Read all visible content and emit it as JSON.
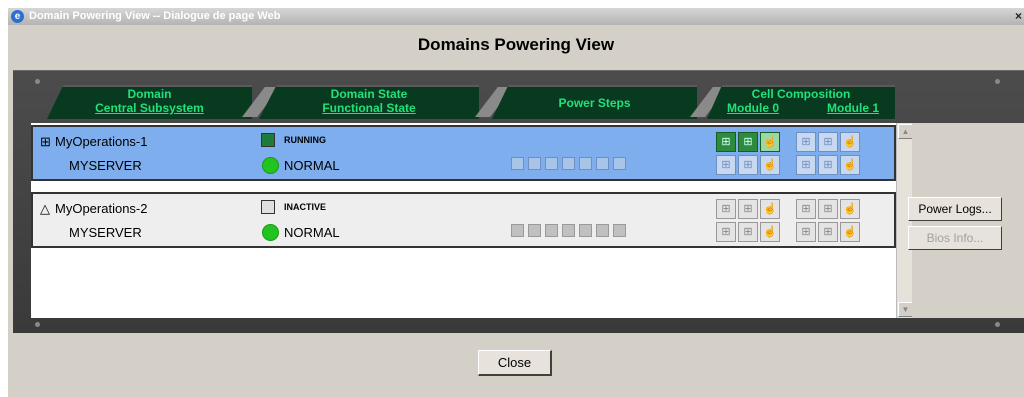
{
  "window": {
    "title": "Domain Powering View -- Dialogue de page Web",
    "close_glyph": "×"
  },
  "dialog": {
    "heading": "Domains Powering View"
  },
  "columns": [
    {
      "line1": "Domain",
      "line2": "Central Subsystem"
    },
    {
      "line1": "Domain State",
      "line2": "Functional State"
    },
    {
      "line1": "Power Steps",
      "line2": ""
    },
    {
      "line1": "Cell Composition",
      "line2": ""
    }
  ],
  "modules": [
    "Module 0",
    "Module 1"
  ],
  "domains": [
    {
      "name": "MyOperations-1",
      "host": "MYSERVER",
      "state": "RUNNING",
      "functional": "NORMAL",
      "selected": true
    },
    {
      "name": "MyOperations-2",
      "host": "MYSERVER",
      "state": "INACTIVE",
      "functional": "NORMAL",
      "selected": false
    }
  ],
  "buttons": {
    "power_logs": "Power Logs...",
    "bios_info": "Bios Info...",
    "close": "Close"
  },
  "colors": {
    "selected_row": "#7eaeee",
    "tab_bg": "#083a20",
    "tab_text": "#22e07a",
    "status_green": "#21c421"
  }
}
